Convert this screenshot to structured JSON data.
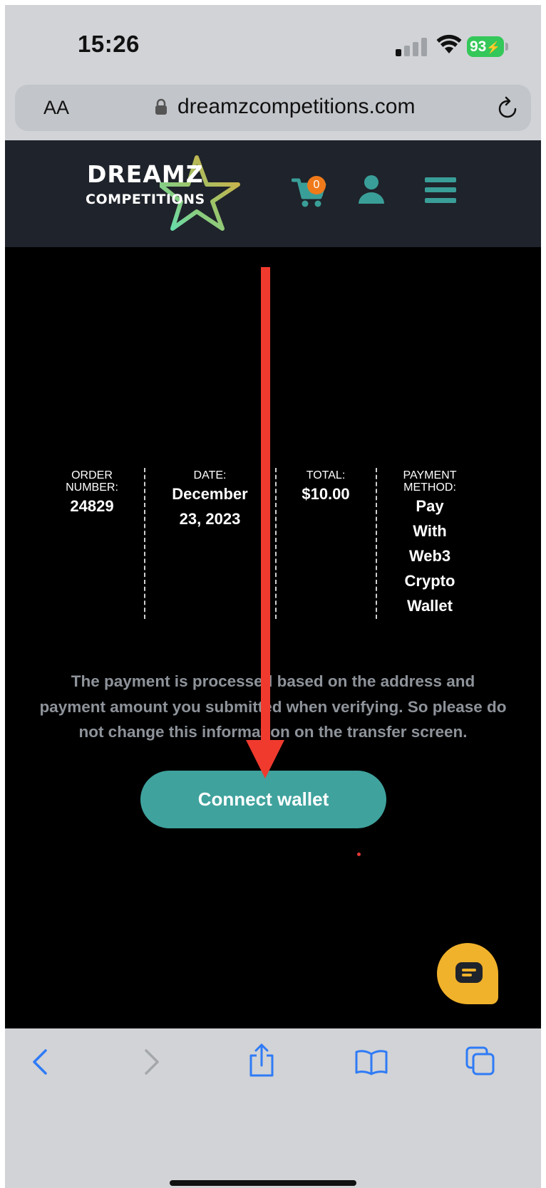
{
  "status_bar": {
    "time": "15:26",
    "battery": "93"
  },
  "address_bar": {
    "text_size_label": "AA",
    "url": "dreamzcompetitions.com"
  },
  "site_header": {
    "logo_line1": "DREAMZ",
    "logo_line2": "COMPETITIONS",
    "cart_count": "0",
    "accent_color": "#3a9e98"
  },
  "order": {
    "number_label": "ORDER NUMBER:",
    "number_value": "24829",
    "date_label": "DATE:",
    "date_value_line1": "December",
    "date_value_line2": "23, 2023",
    "total_label": "TOTAL:",
    "total_value": "$10.00",
    "payment_label": "PAYMENT METHOD:",
    "payment_value_lines": [
      "Pay",
      "With",
      "Web3",
      "Crypto",
      "Wallet"
    ]
  },
  "notice": {
    "line1": "The payment is processed based on the address and",
    "line2": "payment amount you submitted when verifying. So please do",
    "line3": "not change this information on the transfer screen."
  },
  "connect_button_label": "Connect wallet",
  "icons": {
    "back": "chevron-left-icon",
    "forward": "chevron-right-icon",
    "share": "share-icon",
    "bookmarks": "book-icon",
    "tabs": "tabs-icon",
    "chat": "chat-icon"
  }
}
